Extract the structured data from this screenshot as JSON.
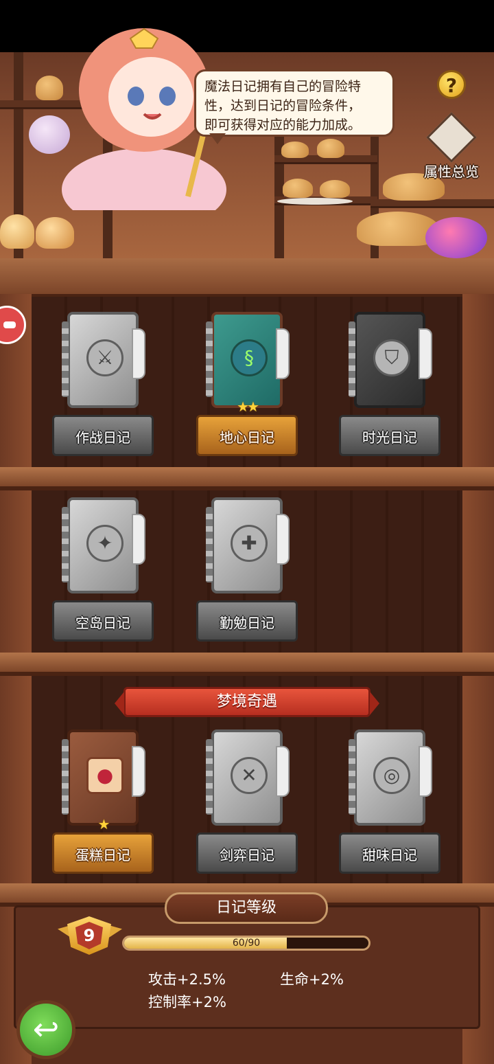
{
  "header": {
    "speech": "魔法日记拥有自己的冒险特\n性，达到日记的冒险条件，\n即可获得对应的能力加成。",
    "help_label": "?",
    "overview_label": "属性总览"
  },
  "shelves": [
    [
      {
        "name": "作战日记",
        "status": "locked",
        "stars": "",
        "icon": "crossed-swords-icon"
      },
      {
        "name": "地心日记",
        "status": "active",
        "stars": "★★",
        "icon": "earth-core-icon"
      },
      {
        "name": "时光日记",
        "status": "locked",
        "stars": "",
        "icon": "shield-icon"
      }
    ],
    [
      {
        "name": "空岛日记",
        "status": "locked",
        "stars": "",
        "icon": "compass-icon"
      },
      {
        "name": "勤勉日记",
        "status": "locked",
        "stars": "",
        "icon": "cross-emblem-icon"
      }
    ],
    [
      {
        "name": "蛋糕日记",
        "status": "active",
        "stars": "★",
        "icon": "cake-icon"
      },
      {
        "name": "剑弈日记",
        "status": "locked",
        "stars": "",
        "icon": "crossed-blades-icon"
      },
      {
        "name": "甜味日记",
        "status": "locked",
        "stars": "",
        "icon": "donut-icon"
      }
    ]
  ],
  "section_banner": "梦境奇遇",
  "level": {
    "title": "日记等级",
    "level": "9",
    "progress_text": "60/90",
    "progress_fraction": 0.667,
    "stats": [
      "攻击+2.5%",
      "生命+2%",
      "控制率+2%"
    ]
  },
  "colors": {
    "active": "#e7a23a",
    "locked": "#8a8a8a",
    "banner": "#e8553c"
  }
}
